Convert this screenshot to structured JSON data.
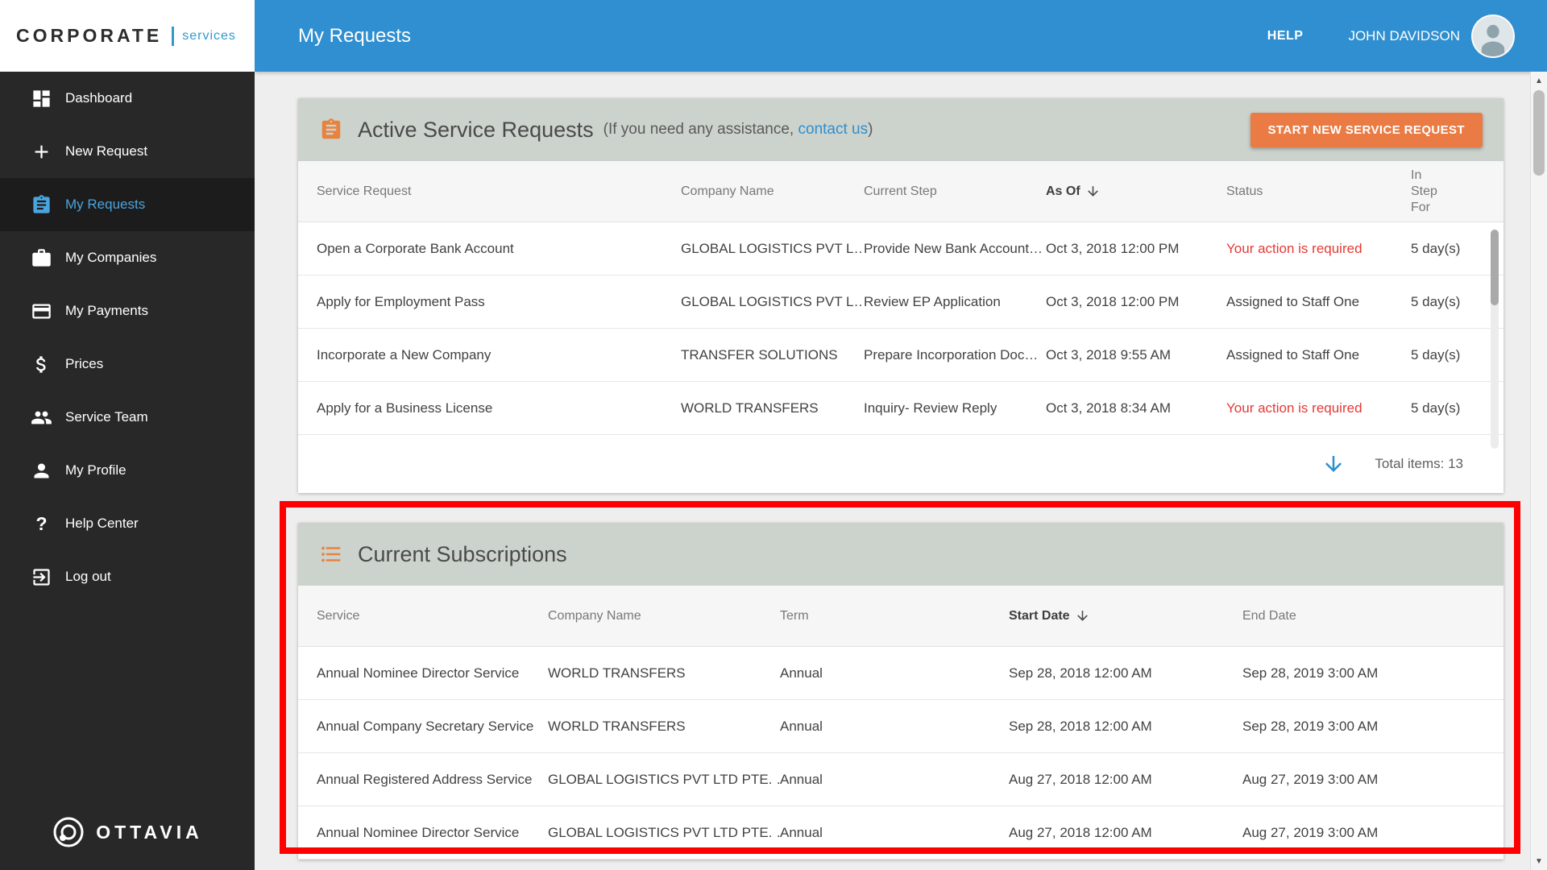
{
  "colors": {
    "header_blue": "#2f8fd0",
    "accent_orange": "#ea7b44",
    "link_blue": "#2e8fd0",
    "alert_red": "#e53935",
    "card_header_gray": "#ccd2cc"
  },
  "brand": {
    "logo_main": "CORPORATE",
    "logo_sub": "services",
    "footer_brand": "OTTAVIA"
  },
  "icons": {
    "help_glyph": "?",
    "scroll_up": "▲",
    "scroll_down": "▼"
  },
  "top_bar": {
    "title": "My Requests",
    "help_label": "HELP",
    "user_name": "JOHN DAVIDSON"
  },
  "sidebar": {
    "items": [
      {
        "label": "Dashboard"
      },
      {
        "label": "New Request"
      },
      {
        "label": "My Requests"
      },
      {
        "label": "My Companies"
      },
      {
        "label": "My Payments"
      },
      {
        "label": "Prices"
      },
      {
        "label": "Service Team"
      },
      {
        "label": "My Profile"
      },
      {
        "label": "Help Center"
      },
      {
        "label": "Log out"
      }
    ]
  },
  "active_requests": {
    "title": "Active Service Requests",
    "assist_prefix": "(If you need any assistance, ",
    "assist_link": "contact us",
    "assist_suffix": ")",
    "new_request_button": "START NEW SERVICE REQUEST",
    "columns": {
      "service": "Service Request",
      "company": "Company Name",
      "step": "Current Step",
      "as_of": "As Of",
      "status": "Status",
      "in_step": "In Step For"
    },
    "rows": [
      {
        "service": "Open a Corporate Bank Account",
        "company": "GLOBAL LOGISTICS PVT L…",
        "step": "Provide New Bank Account…",
        "as_of": "Oct 3, 2018 12:00 PM",
        "status": "Your action is required",
        "status_color": "#e53935",
        "in_step": "5 day(s)"
      },
      {
        "service": "Apply for Employment Pass",
        "company": "GLOBAL LOGISTICS PVT L…",
        "step": "Review EP Application",
        "as_of": "Oct 3, 2018 12:00 PM",
        "status": "Assigned to Staff One",
        "status_color": "#424242",
        "in_step": "5 day(s)"
      },
      {
        "service": "Incorporate a New Company",
        "company": "TRANSFER SOLUTIONS",
        "step": "Prepare Incorporation Doc…",
        "as_of": "Oct 3, 2018 9:55 AM",
        "status": "Assigned to Staff One",
        "status_color": "#424242",
        "in_step": "5 day(s)"
      },
      {
        "service": "Apply for a Business License",
        "company": "WORLD TRANSFERS",
        "step": "Inquiry- Review Reply",
        "as_of": "Oct 3, 2018 8:34 AM",
        "status": "Your action is required",
        "status_color": "#e53935",
        "in_step": "5 day(s)"
      }
    ],
    "total_label": "Total items: 13"
  },
  "subscriptions": {
    "title": "Current Subscriptions",
    "columns": {
      "service": "Service",
      "company": "Company Name",
      "term": "Term",
      "start": "Start Date",
      "end": "End Date"
    },
    "rows": [
      {
        "service": "Annual Nominee Director Service",
        "company": "WORLD TRANSFERS",
        "term": "Annual",
        "start": "Sep 28, 2018 12:00 AM",
        "end": "Sep 28, 2019 3:00 AM"
      },
      {
        "service": "Annual Company Secretary Service",
        "company": "WORLD TRANSFERS",
        "term": "Annual",
        "start": "Sep 28, 2018 12:00 AM",
        "end": "Sep 28, 2019 3:00 AM"
      },
      {
        "service": "Annual Registered Address Service",
        "company": "GLOBAL LOGISTICS PVT LTD PTE. …",
        "term": "Annual",
        "start": "Aug 27, 2018 12:00 AM",
        "end": "Aug 27, 2019 3:00 AM"
      },
      {
        "service": "Annual Nominee Director Service",
        "company": "GLOBAL LOGISTICS PVT LTD PTE. …",
        "term": "Annual",
        "start": "Aug 27, 2018 12:00 AM",
        "end": "Aug 27, 2019 3:00 AM"
      }
    ]
  }
}
